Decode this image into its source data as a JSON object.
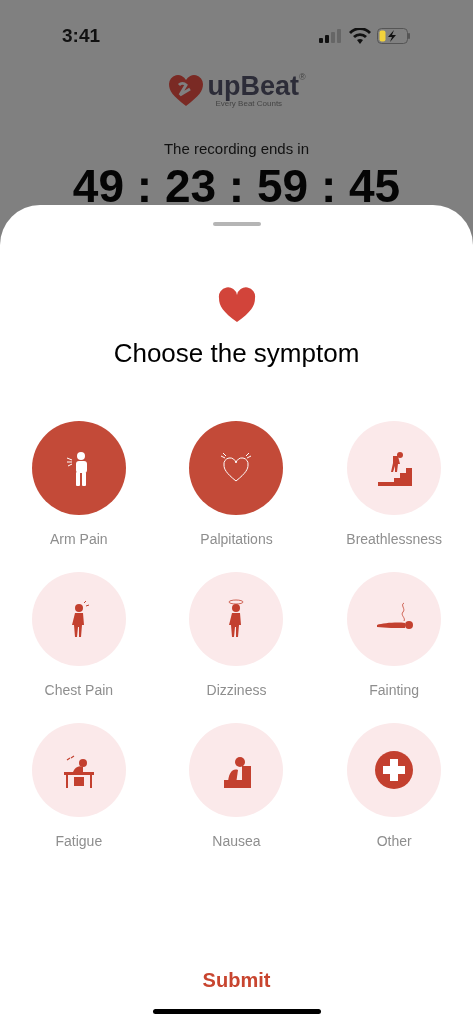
{
  "status_bar": {
    "time": "3:41"
  },
  "logo": {
    "name": "upBeat",
    "mark": "®",
    "tagline": "Every Beat Counts"
  },
  "recording": {
    "label": "The recording ends in",
    "timer": "49 : 23 : 59 : 45"
  },
  "sheet": {
    "title": "Choose the symptom",
    "symptoms": [
      {
        "label": "Arm Pain",
        "kind": "arm",
        "selected": true
      },
      {
        "label": "Palpitations",
        "kind": "heart",
        "selected": true
      },
      {
        "label": "Breathlessness",
        "kind": "stairs",
        "selected": false
      },
      {
        "label": "Chest Pain",
        "kind": "chest",
        "selected": false
      },
      {
        "label": "Dizziness",
        "kind": "dizzy",
        "selected": false
      },
      {
        "label": "Fainting",
        "kind": "faint",
        "selected": false
      },
      {
        "label": "Fatigue",
        "kind": "desk",
        "selected": false
      },
      {
        "label": "Nausea",
        "kind": "nausea",
        "selected": false
      },
      {
        "label": "Other",
        "kind": "cross",
        "selected": false
      }
    ],
    "submit": "Submit"
  }
}
